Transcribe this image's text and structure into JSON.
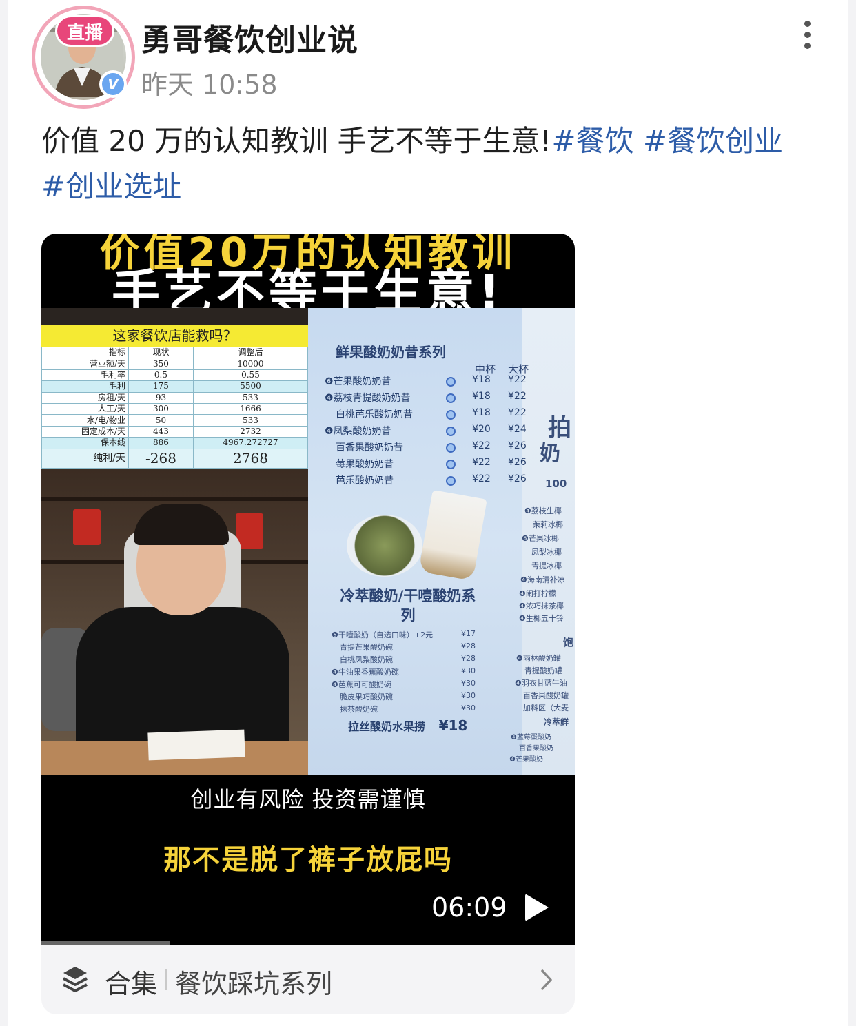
{
  "header": {
    "live_badge": "直播",
    "username": "勇哥餐饮创业说",
    "timestamp": "昨天 10:58",
    "verified_mark": "V"
  },
  "post": {
    "text": "价值 20 万的认知教训 手艺不等于生意!",
    "tags": [
      "#餐饮",
      "#餐饮创业",
      "#创业选址"
    ]
  },
  "video": {
    "title_top": "价值20万的认知教训",
    "title_main": "手艺不等于生意!",
    "sheet": {
      "title": "这家餐饮店能救吗？",
      "columns": [
        "指标",
        "现状",
        "调整后"
      ],
      "rows": [
        [
          "营业额/天",
          "350",
          "10000"
        ],
        [
          "毛利率",
          "0.5",
          "0.55"
        ],
        [
          "毛利",
          "175",
          "5500"
        ],
        [
          "房租/天",
          "93",
          "533"
        ],
        [
          "人工/天",
          "300",
          "1666"
        ],
        [
          "水/电/物业",
          "50",
          "533"
        ],
        [
          "固定成本/天",
          "443",
          "2732"
        ],
        [
          "保本线",
          "886",
          "4967.272727"
        ]
      ],
      "total": [
        "纯利/天",
        "-268",
        "2768"
      ]
    },
    "menu": {
      "section1": "鲜果酸奶奶昔系列",
      "size_headers": [
        "中杯",
        "大杯"
      ],
      "items1": [
        [
          "❻芒果酸奶奶昔",
          "¥18",
          "¥22"
        ],
        [
          "❹荔枝青提酸奶奶昔",
          "¥18",
          "¥22"
        ],
        [
          "白桃芭乐酸奶奶昔",
          "¥18",
          "¥22"
        ],
        [
          "❹凤梨酸奶奶昔",
          "¥20",
          "¥24"
        ],
        [
          "百香果酸奶奶昔",
          "¥22",
          "¥26"
        ],
        [
          "莓果酸奶奶昔",
          "¥22",
          "¥26"
        ],
        [
          "芭乐酸奶奶昔",
          "¥22",
          "¥26"
        ]
      ],
      "section2": "冷萃酸奶/干噎酸奶系列",
      "items2": [
        [
          "❺干噎酸奶（自选口味）+2元",
          "¥17"
        ],
        [
          "青提芒果酸奶碗",
          "¥28"
        ],
        [
          "白桃凤梨酸奶碗",
          "¥28"
        ],
        [
          "❹牛油果香蕉酸奶碗",
          "¥30"
        ],
        [
          "❹芭蕉可可酸奶碗",
          "¥30"
        ],
        [
          "脆皮果巧酸奶碗",
          "¥30"
        ],
        [
          "抹茶酸奶碗",
          "¥30"
        ]
      ],
      "featured": "拉丝酸奶水果捞",
      "featured_price": "¥18",
      "right_items": [
        "❹荔枝生椰",
        "茉莉冰椰",
        "❻芒果冰椰",
        "凤梨冰椰",
        "青提冰椰",
        "❹海南清补凉",
        "❹闹打柠檬",
        "❹浓巧抹茶椰",
        "❹生椰五十铃",
        "❹雨林酸奶罐",
        "青提酸奶罐",
        "❹羽衣甘蓝牛油",
        "百香果酸奶罐",
        "加料区（大麦",
        "冷萃鲜",
        "❹蓝莓蛋酸奶",
        "百香果酸奶",
        "❹芒果酸奶"
      ],
      "right_big": [
        "拍",
        "奶",
        "100",
        "饱"
      ]
    },
    "subtitle1": "创业有风险 投资需谨慎",
    "subtitle2": "那不是脱了裤子放屁吗",
    "duration": "06:09",
    "progress": 0.24
  },
  "collection": {
    "label": "合集",
    "name": "餐饮踩坑系列"
  },
  "colors": {
    "tag": "#2d5ca8",
    "live": "#e8467a",
    "subtitle_yellow": "#f6d33a"
  },
  "icons": [
    "more-vertical-icon",
    "verified-icon",
    "play-icon",
    "layers-icon",
    "chevron-right-icon"
  ]
}
